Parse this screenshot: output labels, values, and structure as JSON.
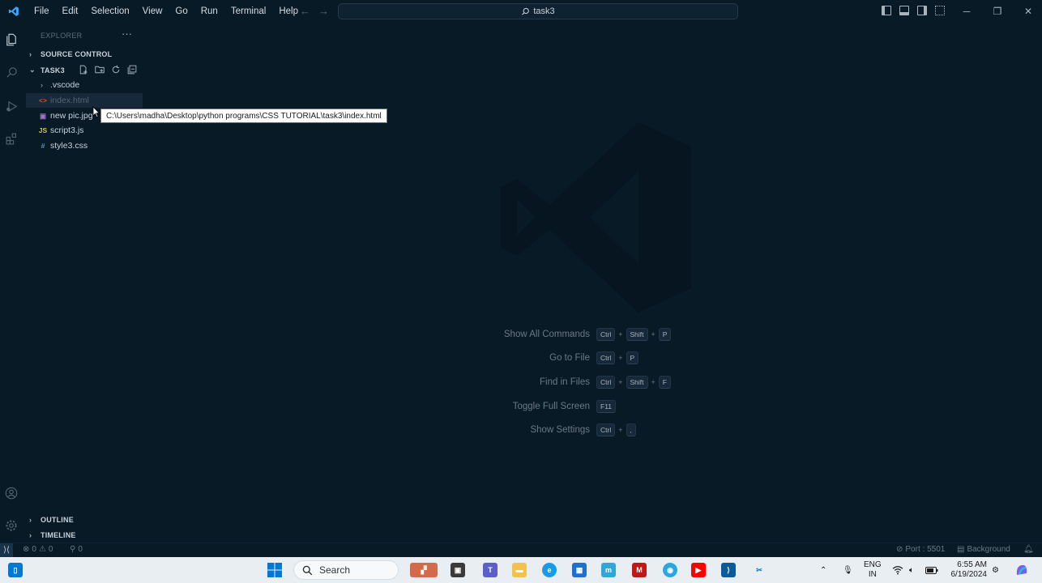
{
  "window": {
    "search_title": "task3"
  },
  "menu": [
    "File",
    "Edit",
    "Selection",
    "View",
    "Go",
    "Run",
    "Terminal",
    "Help"
  ],
  "sidebar": {
    "header": "EXPLORER",
    "source_control": "SOURCE CONTROL",
    "folder": "TASK3",
    "items": [
      {
        "name": ".vscode",
        "icon": "chevron-right-icon"
      },
      {
        "name": "index.html",
        "icon": "html-file-icon",
        "icon_glyph": "<>",
        "icon_color": "#e44d26"
      },
      {
        "name": "new pic.jpg",
        "icon": "image-file-icon",
        "icon_glyph": "▣",
        "icon_color": "#a074c4"
      },
      {
        "name": "script3.js",
        "icon": "js-file-icon",
        "icon_glyph": "JS",
        "icon_color": "#cbcb41"
      },
      {
        "name": "style3.css",
        "icon": "css-file-icon",
        "icon_glyph": "#",
        "icon_color": "#519aba"
      }
    ],
    "outline": "OUTLINE",
    "timeline": "TIMELINE"
  },
  "tooltip": "C:\\Users\\madha\\Desktop\\python programs\\CSS TUTORIAL\\task3\\index.html",
  "shortcuts": [
    {
      "label": "Show All Commands",
      "keys": [
        "Ctrl",
        "Shift",
        "P"
      ]
    },
    {
      "label": "Go to File",
      "keys": [
        "Ctrl",
        "P"
      ]
    },
    {
      "label": "Find in Files",
      "keys": [
        "Ctrl",
        "Shift",
        "F"
      ]
    },
    {
      "label": "Toggle Full Screen",
      "keys": [
        "F11"
      ]
    },
    {
      "label": "Show Settings",
      "keys": [
        "Ctrl",
        ","
      ]
    }
  ],
  "status": {
    "errors": "0",
    "warnings": "0",
    "ports": "0",
    "port": "Port : 5501",
    "background": "Background"
  },
  "taskbar": {
    "search": "Search",
    "lang_top": "ENG",
    "lang_bottom": "IN",
    "time": "6:55 AM",
    "date": "6/19/2024"
  },
  "colors": {
    "background": "#081a26",
    "accent": "#0078d4",
    "taskbar": "#e9eef3"
  }
}
